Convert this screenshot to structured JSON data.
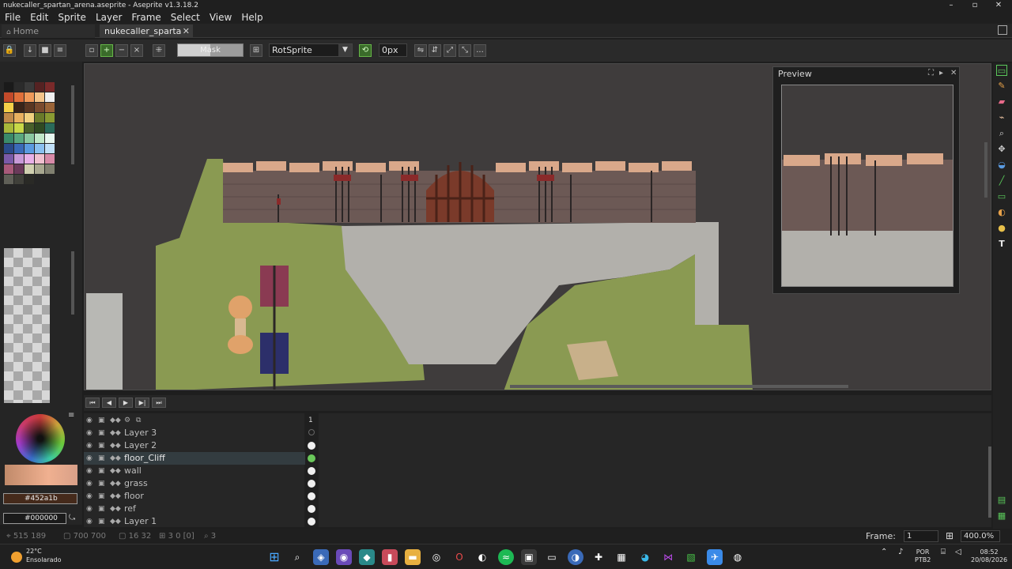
{
  "window": {
    "title": "nukecaller_spartan_arena.aseprite - Aseprite v1.3.18.2"
  },
  "menu": [
    "File",
    "Edit",
    "Sprite",
    "Layer",
    "Frame",
    "Select",
    "View",
    "Help"
  ],
  "tabs": [
    {
      "label": "Home",
      "active": false
    },
    {
      "label": "nukecaller_sparta",
      "active": true
    }
  ],
  "toolbar": {
    "mask_label": "Mask",
    "rotation_algorithm": "RotSprite",
    "tolerance": "0px",
    "more": "..."
  },
  "colors": {
    "foreground": "#452a1b",
    "background": "#000000"
  },
  "palette": [
    "#1a1a1a",
    "#2b2b2b",
    "#3a3a3a",
    "#552222",
    "#7a2a2a",
    "#c24a2a",
    "#e0703a",
    "#f09a5a",
    "#f4c48a",
    "#f0f0f0",
    "#f5d048",
    "#3a2418",
    "#5a3622",
    "#7a4a2e",
    "#9a6438",
    "#c08a4a",
    "#e8b060",
    "#f0d080",
    "#6a7a2a",
    "#8a9a32",
    "#a8b83a",
    "#c8d848",
    "#48602a",
    "#2f4a22",
    "#2a6a5a",
    "#3a8a6a",
    "#5aa880",
    "#8ac8a0",
    "#c0e8c8",
    "#e8f8f0",
    "#2a4a8a",
    "#3a6ab8",
    "#5a9ae0",
    "#8ac0f0",
    "#c0e0f8",
    "#7a5aa8",
    "#c89ad8",
    "#e8b0e8",
    "#f0c0d0",
    "#d88aa8",
    "#a85a7a",
    "#6a3a5a",
    "#d0d0b0",
    "#a8a890",
    "#808070",
    "#606058",
    "#40403a",
    "#2a2a26"
  ],
  "preview": {
    "title": "Preview"
  },
  "timeline": {
    "frame_number": "1",
    "layers": [
      {
        "name": "Layer 3",
        "selected": false,
        "cel": "empty"
      },
      {
        "name": "Layer 2",
        "selected": false,
        "cel": "filled"
      },
      {
        "name": "floor_Cliff",
        "selected": true,
        "cel": "filled"
      },
      {
        "name": "wall",
        "selected": false,
        "cel": "filled"
      },
      {
        "name": "grass",
        "selected": false,
        "cel": "filled"
      },
      {
        "name": "floor",
        "selected": false,
        "cel": "filled"
      },
      {
        "name": "ref",
        "selected": false,
        "cel": "filled"
      },
      {
        "name": "Layer 1",
        "selected": false,
        "cel": "filled"
      }
    ]
  },
  "status": {
    "coords": "515 189",
    "size_a": "700 700",
    "size_b": "16 32",
    "grid": "3 0 [0]",
    "extra": "3",
    "frame_label": "Frame:",
    "frame_value": "1",
    "zoom": "400.0%"
  },
  "taskbar": {
    "temperature": "22°C",
    "weather": "Ensolarado",
    "lang_top": "POR",
    "lang_bottom": "PTB2",
    "time": "08:52",
    "date": "20/08/2026"
  }
}
